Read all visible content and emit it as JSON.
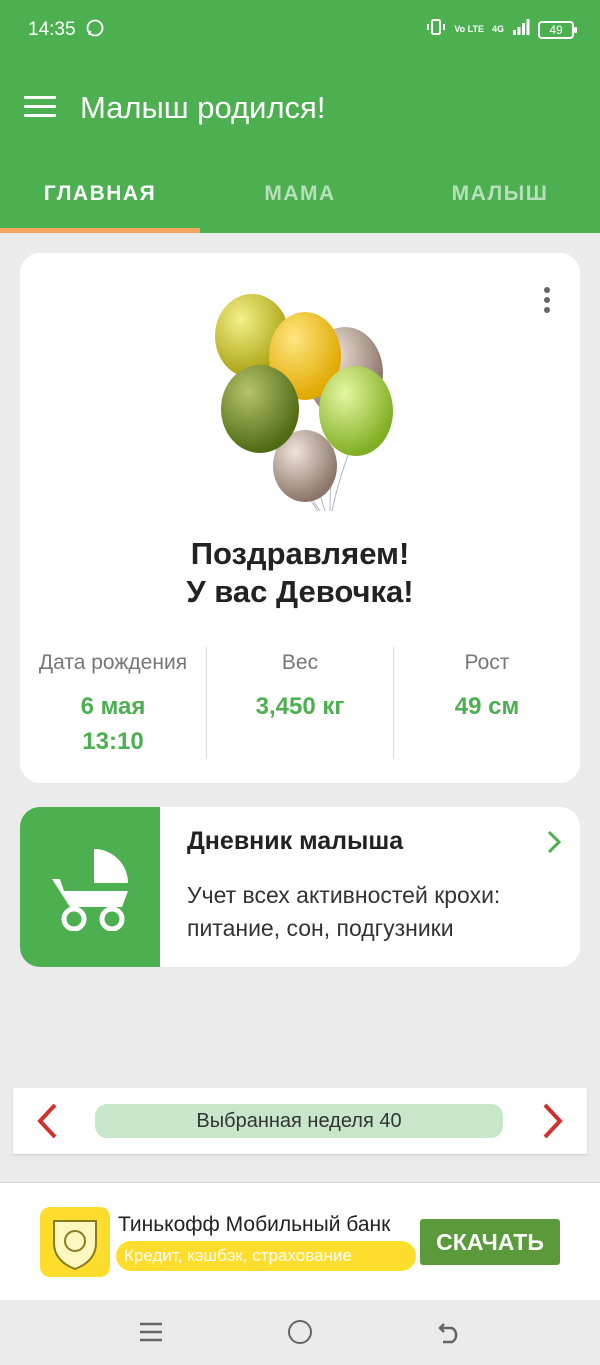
{
  "status_bar": {
    "time": "14:35",
    "network": "Vo LTE",
    "signal": "4G",
    "battery": "49"
  },
  "app_bar": {
    "title": "Малыш родился!",
    "menu_icon": "hamburger-icon"
  },
  "tabs": [
    {
      "label": "ГЛАВНАЯ",
      "active": true
    },
    {
      "label": "МАМА",
      "active": false
    },
    {
      "label": "МАЛЫШ",
      "active": false
    }
  ],
  "birth_card": {
    "congrats_line1": "Поздравляем!",
    "congrats_line2": "У вас Девочка!",
    "stats": [
      {
        "label": "Дата рождения",
        "value_line1": "6 мая",
        "value_line2": "13:10"
      },
      {
        "label": "Вес",
        "value_line1": "3,450 кг",
        "value_line2": ""
      },
      {
        "label": "Рост",
        "value_line1": "49 см",
        "value_line2": ""
      }
    ]
  },
  "diary_card": {
    "title": "Дневник малыша",
    "description": "Учет всех активностей крохи: питание, сон, подгузники"
  },
  "week_selector": {
    "label": "Выбранная неделя 40"
  },
  "ad": {
    "title": "Тинькофф Мобильный банк",
    "subtitle": "Кредит, кэшбэк, страхование",
    "button": "СКАЧАТЬ"
  },
  "colors": {
    "primary": "#4caf50",
    "tab_indicator": "#f4a460",
    "accent_red": "#d32f2f",
    "ad_yellow": "#ffdd2d"
  }
}
